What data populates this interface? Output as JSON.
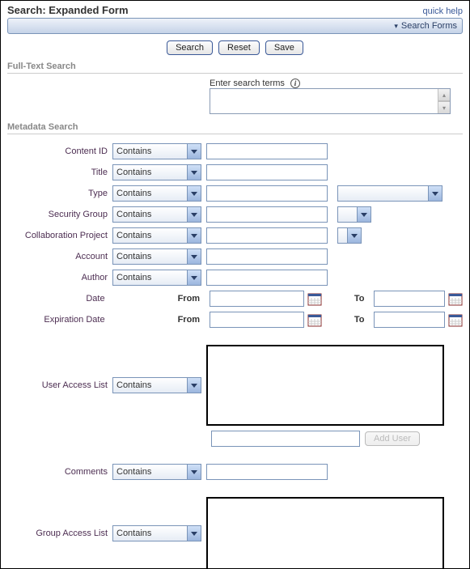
{
  "header": {
    "title": "Search: Expanded Form",
    "quick_help": "quick help",
    "search_forms": "Search Forms"
  },
  "buttons": {
    "search": "Search",
    "reset": "Reset",
    "save": "Save"
  },
  "sections": {
    "full_text": "Full-Text Search",
    "metadata": "Metadata Search"
  },
  "full_text": {
    "enter_label": "Enter search terms"
  },
  "fields": {
    "content_id": {
      "label": "Content ID",
      "op": "Contains"
    },
    "title": {
      "label": "Title",
      "op": "Contains"
    },
    "type": {
      "label": "Type",
      "op": "Contains"
    },
    "security_group": {
      "label": "Security Group",
      "op": "Contains"
    },
    "collab_project": {
      "label": "Collaboration Project",
      "op": "Contains"
    },
    "account": {
      "label": "Account",
      "op": "Contains"
    },
    "author": {
      "label": "Author",
      "op": "Contains"
    },
    "date": {
      "label": "Date",
      "from": "From",
      "to": "To"
    },
    "expiration_date": {
      "label": "Expiration Date",
      "from": "From",
      "to": "To"
    },
    "user_access_list": {
      "label": "User Access List",
      "op": "Contains",
      "add_btn": "Add User"
    },
    "comments": {
      "label": "Comments",
      "op": "Contains"
    },
    "group_access_list": {
      "label": "Group Access List",
      "op": "Contains"
    }
  }
}
